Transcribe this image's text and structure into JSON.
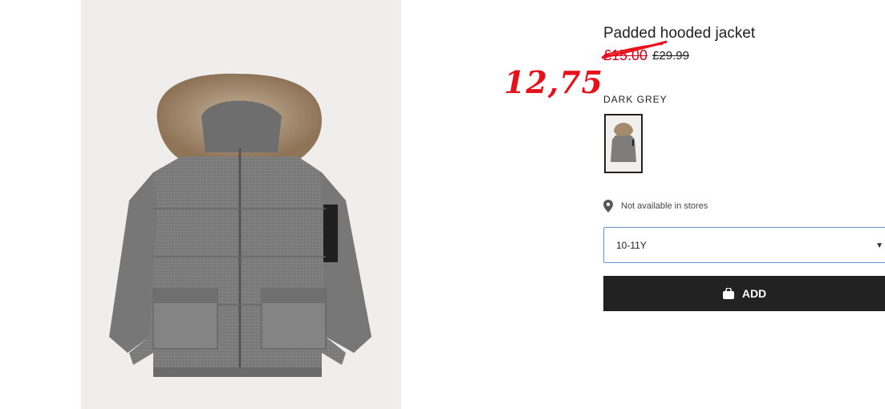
{
  "product": {
    "title": "Padded hooded jacket",
    "sale_price": "£15.00",
    "original_price": "£29.99",
    "color_name": "DARK GREY",
    "availability_text": "Not available in stores",
    "size_selected": "10-11Y",
    "add_label": "ADD"
  },
  "annotation": {
    "handwritten_price": "12,75",
    "color": "#e8111b"
  },
  "colors": {
    "button_bg": "#222222",
    "sale_red": "#d6001c",
    "select_border": "#6d8fd8",
    "image_bg": "#efeeec"
  },
  "icons": {
    "location": "location-pin-icon",
    "bag": "shopping-bag-icon",
    "chevron": "chevron-down-icon"
  }
}
